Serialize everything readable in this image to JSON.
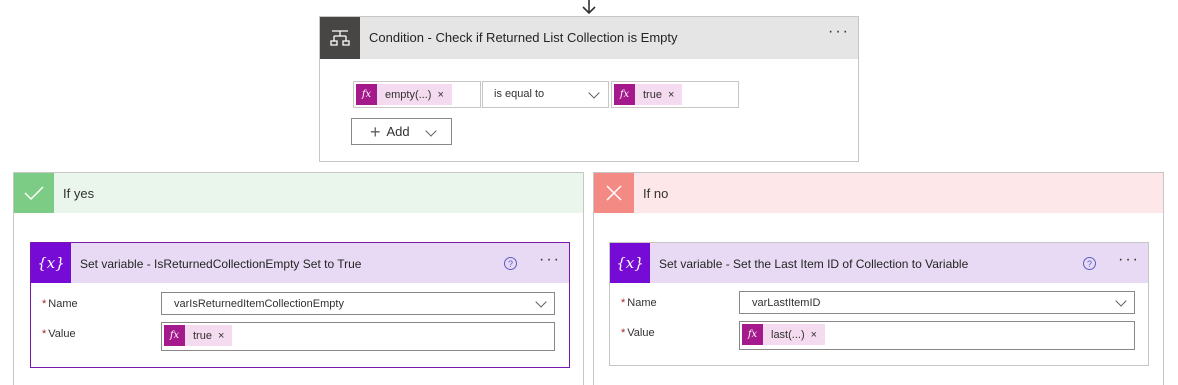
{
  "condition": {
    "title": "Condition - Check if Returned List Collection is Empty",
    "left_token": "empty(...)",
    "operator": "is equal to",
    "right_token": "true",
    "remove_symbol": "×",
    "add_label": "Add",
    "menu_symbol": "···"
  },
  "fx_label": "fx",
  "var_icon_label": "{x}",
  "help_symbol": "?",
  "yes_branch": {
    "label": "If yes",
    "action": {
      "title": "Set variable - IsReturnedCollectionEmpty Set to True",
      "name_label": "Name",
      "name_value": "varIsReturnedItemCollectionEmpty",
      "value_label": "Value",
      "value_token": "true"
    }
  },
  "no_branch": {
    "label": "If no",
    "action": {
      "title": "Set variable - Set the Last Item ID of Collection to Variable",
      "name_label": "Name",
      "name_value": "varLastItemID",
      "value_label": "Value",
      "value_token": "last(...)"
    }
  },
  "required_marker": "*",
  "colors": {
    "condition_icon_bg": "#484644",
    "expression_token": "#a4198b",
    "token_bg": "#f4dbef",
    "variable_icon_bg": "#770bd6",
    "yes_accent": "#7ccc85",
    "no_accent": "#f48a84",
    "selected_border": "#7719aa"
  }
}
